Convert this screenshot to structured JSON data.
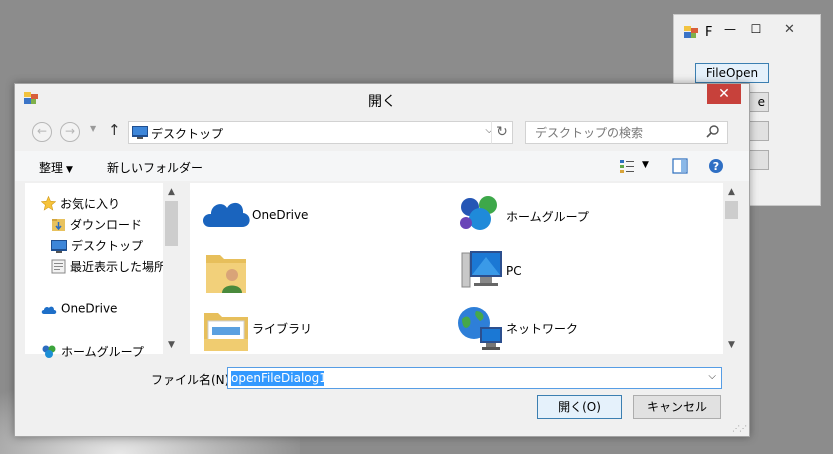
{
  "background_window": {
    "title": "F",
    "controls": {
      "minimize": "—",
      "maximize": "☐",
      "close": "✕"
    },
    "buttons": [
      "FileOpen",
      "",
      "",
      ""
    ],
    "peek_text": "e"
  },
  "dialog": {
    "title": "開く",
    "close": "✕",
    "nav": {
      "back": "←",
      "forward": "→",
      "dropdown": "▼",
      "up": "↑"
    },
    "address": {
      "location": "デスクトップ",
      "dropdown": "⌵",
      "refresh": "↻"
    },
    "search": {
      "placeholder": "デスクトップの検索"
    },
    "commands": {
      "organize": "整理",
      "organize_caret": "▼",
      "new_folder": "新しいフォルダー",
      "views_caret": "▼"
    },
    "nav_pane": {
      "favorites": "お気に入り",
      "downloads": "ダウンロード",
      "desktop": "デスクトップ",
      "recent": "最近表示した場所",
      "onedrive": "OneDrive",
      "homegroup": "ホームグループ"
    },
    "items": [
      {
        "label": "OneDrive",
        "icon": "onedrive-icon"
      },
      {
        "label": "ホームグループ",
        "icon": "homegroup-icon"
      },
      {
        "label": "",
        "icon": "user-folder-icon"
      },
      {
        "label": "PC",
        "icon": "pc-icon"
      },
      {
        "label": "ライブラリ",
        "icon": "libraries-icon"
      },
      {
        "label": "ネットワーク",
        "icon": "network-icon"
      }
    ],
    "file_name_label": "ファイル名(N):",
    "file_name_value": "openFileDialog1",
    "open_button": "開く(O)",
    "cancel_button": "キャンセル",
    "scroll_arrows": {
      "up": "▲",
      "down": "▼"
    }
  },
  "colors": {
    "accent": "#3399ff",
    "close_red": "#c7413b",
    "primary_border": "#3c7fb1"
  }
}
